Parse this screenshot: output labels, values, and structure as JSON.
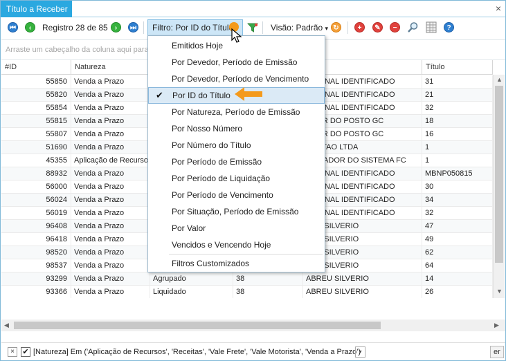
{
  "tab": {
    "title": "Título a Receber",
    "close_glyph": "×"
  },
  "toolbar": {
    "registro_text": "Registro 28 de 85",
    "filter_label": "Filtro: Por ID do Título",
    "visao_label": "Visão: Padrão",
    "visao_arrow": "▾",
    "icons": [
      "first-icon",
      "prev-icon",
      "next-icon",
      "last-icon",
      "filter-edit-icon",
      "refresh-icon",
      "add-icon",
      "edit-icon",
      "remove-icon",
      "search-icon",
      "grid-icon",
      "help-icon"
    ],
    "help_glyph": "?"
  },
  "group_panel": {
    "placeholder": "Arraste um cabeçalho da coluna aqui para a"
  },
  "grid": {
    "columns": [
      "#ID",
      "Natureza",
      "",
      "",
      "",
      "Título"
    ],
    "rows": [
      {
        "id": "55850",
        "natureza": "Venda a Prazo",
        "situacao": "",
        "dias": "",
        "devedor": "TE FINAL IDENTIFICADO",
        "titulo": "31"
      },
      {
        "id": "55820",
        "natureza": "Venda a Prazo",
        "situacao": "",
        "dias": "",
        "devedor": "TE FINAL IDENTIFICADO",
        "titulo": "21"
      },
      {
        "id": "55854",
        "natureza": "Venda a Prazo",
        "situacao": "",
        "dias": "",
        "devedor": "TE FINAL IDENTIFICADO",
        "titulo": "32"
      },
      {
        "id": "55815",
        "natureza": "Venda a Prazo",
        "situacao": "",
        "dias": "",
        "devedor": "ADOR DO POSTO GC",
        "titulo": "18"
      },
      {
        "id": "55807",
        "natureza": "Venda a Prazo",
        "situacao": "",
        "dias": "",
        "devedor": "ADOR DO POSTO GC",
        "titulo": "16"
      },
      {
        "id": "51690",
        "natureza": "Venda a Prazo",
        "situacao": "",
        "dias": "",
        "devedor": "POSTAO LTDA",
        "titulo": "1"
      },
      {
        "id": "45355",
        "natureza": "Aplicação de Recursos",
        "situacao": "",
        "dias": "",
        "devedor": "ISTRADOR DO SISTEMA FC",
        "titulo": "1"
      },
      {
        "id": "88932",
        "natureza": "Venda a Prazo",
        "situacao": "",
        "dias": "",
        "devedor": "TE FINAL IDENTIFICADO",
        "titulo": "MBNP050815"
      },
      {
        "id": "56000",
        "natureza": "Venda a Prazo",
        "situacao": "",
        "dias": "",
        "devedor": "TE FINAL IDENTIFICADO",
        "titulo": "30"
      },
      {
        "id": "56024",
        "natureza": "Venda a Prazo",
        "situacao": "",
        "dias": "",
        "devedor": "TE FINAL IDENTIFICADO",
        "titulo": "34"
      },
      {
        "id": "56019",
        "natureza": "Venda a Prazo",
        "situacao": "",
        "dias": "",
        "devedor": "TE FINAL IDENTIFICADO",
        "titulo": "32"
      },
      {
        "id": "96408",
        "natureza": "Venda a Prazo",
        "situacao": "",
        "dias": "",
        "devedor": "REU SILVERIO",
        "titulo": "47"
      },
      {
        "id": "96418",
        "natureza": "Venda a Prazo",
        "situacao": "",
        "dias": "",
        "devedor": "REU SILVERIO",
        "titulo": "49"
      },
      {
        "id": "98520",
        "natureza": "Venda a Prazo",
        "situacao": "",
        "dias": "",
        "devedor": "REU SILVERIO",
        "titulo": "62"
      },
      {
        "id": "98537",
        "natureza": "Venda a Prazo",
        "situacao": "",
        "dias": "",
        "devedor": "REU SILVERIO",
        "titulo": "64"
      },
      {
        "id": "93299",
        "natureza": "Venda a Prazo",
        "situacao": "Agrupado",
        "dias": "38",
        "devedor": "ABREU SILVERIO",
        "titulo": "14"
      },
      {
        "id": "93366",
        "natureza": "Venda a Prazo",
        "situacao": "Liquidado",
        "dias": "38",
        "devedor": "ABREU SILVERIO",
        "titulo": "26"
      }
    ]
  },
  "filter_bar": {
    "close_glyph": "×",
    "check_glyph": "✔",
    "expression": "[Natureza] Em ('Aplicação de Recursos', 'Receitas', 'Vale Frete', 'Vale Motorista', 'Venda a Prazo')",
    "dropdown_glyph": "▾",
    "button_label": "er"
  },
  "filter_menu": {
    "check_glyph": "✔",
    "items": [
      "Emitidos Hoje",
      "Por Devedor, Período de Emissão",
      "Por Devedor, Período de Vencimento",
      "Por ID do Título",
      "Por Natureza, Período de Emissão",
      "Por Nosso Número",
      "Por Número do Título",
      "Por Período de Emissão",
      "Por Período de Liquidação",
      "Por Período de Vencimento",
      "Por Situação, Período de Emissão",
      "Por Valor",
      "Vencidos e Vencendo Hoje"
    ],
    "selected_index": 3,
    "custom_item": "Filtros Customizados"
  },
  "colors": {
    "tab_bg": "#2aa8e0",
    "highlight_arrow": "#f49a1c",
    "selected_row": "#c8dcea"
  }
}
